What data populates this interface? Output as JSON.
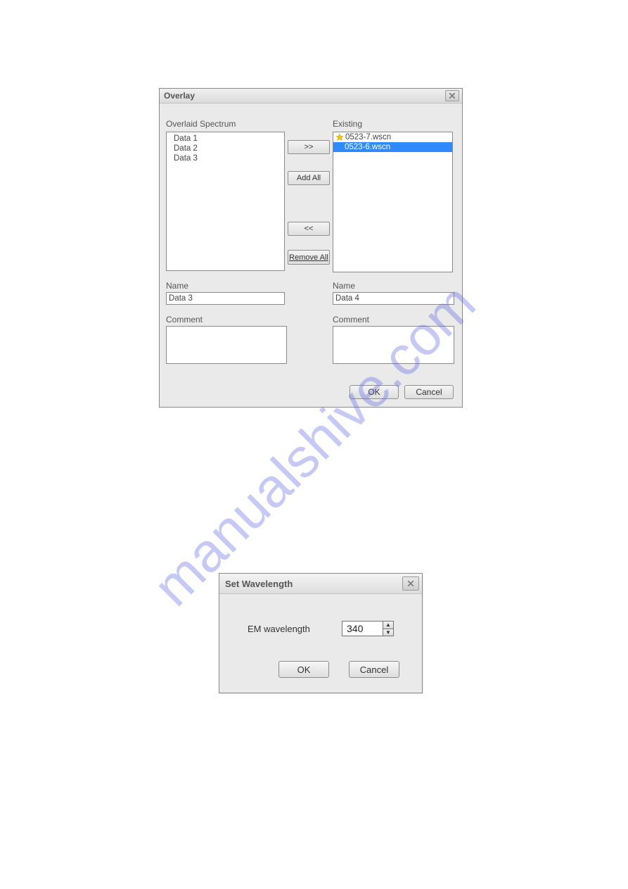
{
  "watermark": "manualshive.com",
  "overlay": {
    "title": "Overlay",
    "lbl_overlaid": "Overlaid Spectrum",
    "lbl_existing": "Existing",
    "overlaid_items": [
      "Data 1",
      "Data 2",
      "Data 3"
    ],
    "existing_items": [
      {
        "label": "0523-7.wscn",
        "selected": false
      },
      {
        "label": "0523-6.wscn",
        "selected": true
      }
    ],
    "icon_star": "star-icon",
    "btn_add": ">>",
    "btn_addall": "Add All",
    "btn_remove": "<<",
    "btn_removeall": "Remove All",
    "lbl_name": "Name",
    "name_left": "Data 3",
    "name_right": "Data 4",
    "lbl_comment": "Comment",
    "comment_left": "",
    "comment_right": "",
    "btn_ok": "OK",
    "btn_cancel": "Cancel"
  },
  "wave": {
    "title": "Set Wavelength",
    "lbl_em": "EM wavelength",
    "value": "340",
    "btn_ok": "OK",
    "btn_cancel": "Cancel"
  }
}
